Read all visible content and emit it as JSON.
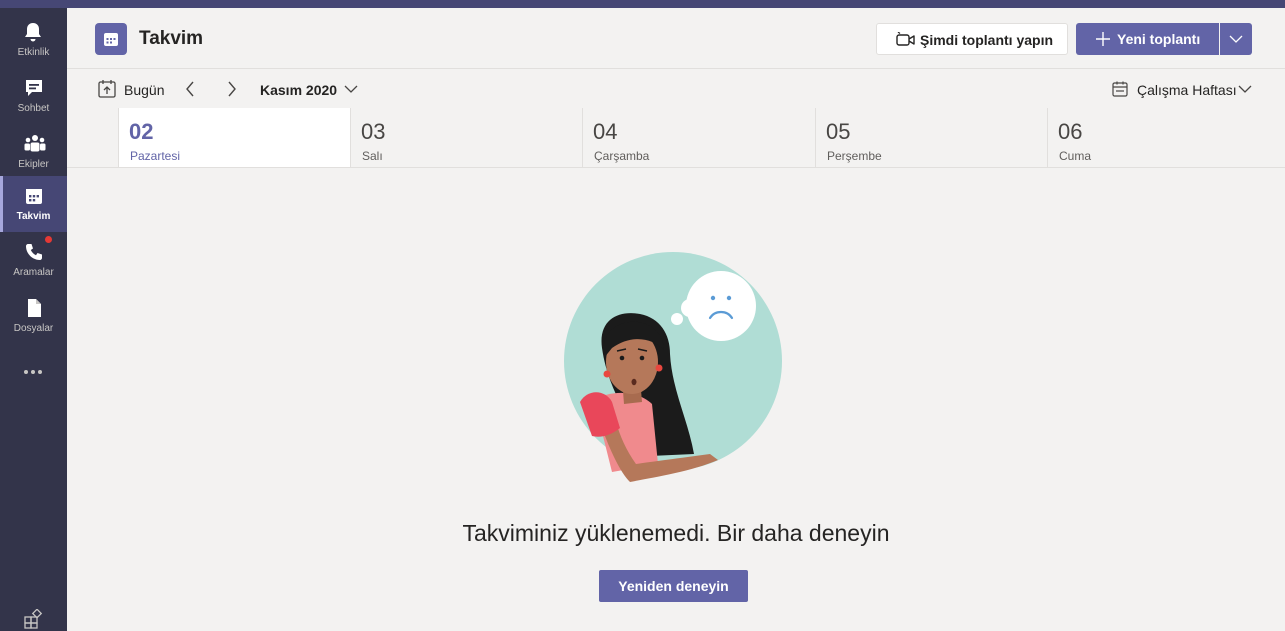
{
  "rail": {
    "items": [
      {
        "label": "Etkinlik",
        "icon": "bell-icon"
      },
      {
        "label": "Sohbet",
        "icon": "chat-icon"
      },
      {
        "label": "Ekipler",
        "icon": "teams-icon"
      },
      {
        "label": "Takvim",
        "icon": "calendar-icon"
      },
      {
        "label": "Aramalar",
        "icon": "phone-icon"
      },
      {
        "label": "Dosyalar",
        "icon": "file-icon"
      }
    ],
    "active": "Takvim",
    "notification_dot_on": "Aramalar"
  },
  "header": {
    "title": "Takvim",
    "meet_now_label": "Şimdi toplantı yapın",
    "new_meeting_label": "Yeni toplantı"
  },
  "toolbar": {
    "today_label": "Bugün",
    "month_label": "Kasım 2020",
    "view_label": "Çalışma Haftası"
  },
  "days": [
    {
      "num": "02",
      "name": "Pazartesi",
      "selected": true
    },
    {
      "num": "03",
      "name": "Salı"
    },
    {
      "num": "04",
      "name": "Çarşamba"
    },
    {
      "num": "05",
      "name": "Perşembe"
    },
    {
      "num": "06",
      "name": "Cuma"
    }
  ],
  "error": {
    "message": "Takviminiz yüklenemedi. Bir daha deneyin",
    "retry_label": "Yeniden deneyin"
  },
  "colors": {
    "accent": "#6264a7",
    "rail": "#33344a",
    "background": "#f3f2f1"
  }
}
